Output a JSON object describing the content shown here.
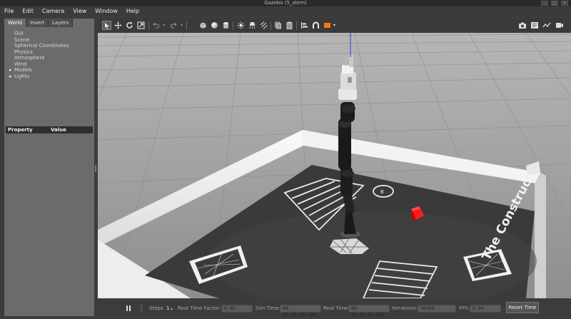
{
  "window": {
    "title": "Gazebo (5_stem)",
    "btn_min": "–",
    "btn_max": "□",
    "btn_close": "×"
  },
  "menu": [
    "File",
    "Edit",
    "Camera",
    "View",
    "Window",
    "Help"
  ],
  "left_panel": {
    "tabs": [
      "World",
      "Insert",
      "Layers"
    ],
    "tree": [
      "GUI",
      "Scene",
      "Spherical Coordinates",
      "Physics",
      "Atmosphere",
      "Wind",
      "Models",
      "Lights"
    ],
    "property_header": "Property",
    "value_header": "Value"
  },
  "toolbar": {
    "icons": [
      "select-icon",
      "translate-icon",
      "rotate-icon",
      "scale-icon",
      "undo-icon",
      "redo-icon",
      "box-icon",
      "sphere-icon",
      "cylinder-icon",
      "point-light-icon",
      "spot-light-icon",
      "directional-light-icon",
      "copy-icon",
      "paste-icon",
      "align-icon",
      "snap-icon",
      "change-view-icon",
      "screenshot-icon",
      "log-icon",
      "plot-icon",
      "record-icon"
    ],
    "accent": "#f07a1a"
  },
  "scene": {
    "arena_label": "The Construct"
  },
  "bottom": {
    "play_icon": "pause-icon",
    "steps_label": "Steps",
    "steps_value": "1",
    "rtf_label": "Real Time Factor:",
    "rtf_value": "0.95",
    "sim_label": "Sim Time:",
    "sim_value": "00 00:00:38.288",
    "real_label": "Real Time:",
    "real_value": "00 00:00:41.463",
    "iter_label": "Iterations:",
    "iter_value": "38288",
    "fps_label": "FPS:",
    "fps_value": "5.00",
    "reset_label": "Reset Time"
  }
}
